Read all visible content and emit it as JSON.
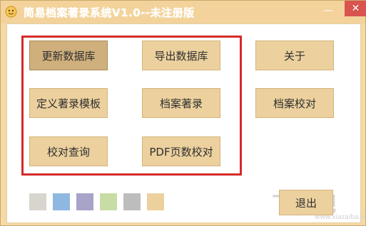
{
  "window": {
    "title": "简易档案著录系统V1.0--未注册版",
    "minimize_icon": "minimize-icon",
    "close_icon": "close-icon",
    "minimize_glyph": "—",
    "close_glyph": "✕"
  },
  "buttons": {
    "update_db": "更新数据库",
    "export_db": "导出数据库",
    "about": "关于",
    "define_template": "定义著录模板",
    "archive_record": "档案著录",
    "archive_check": "档案校对",
    "check_query": "校对查询",
    "pdf_page_check": "PDF页数校对",
    "exit": "退出"
  },
  "theme_swatches": [
    "#d8d5cf",
    "#8fb8e0",
    "#a8a3c9",
    "#c8dca6",
    "#bdbdbd",
    "#ecd19e"
  ],
  "watermark": {
    "text": "下载吧",
    "url": "www.xiazaiba.com"
  }
}
